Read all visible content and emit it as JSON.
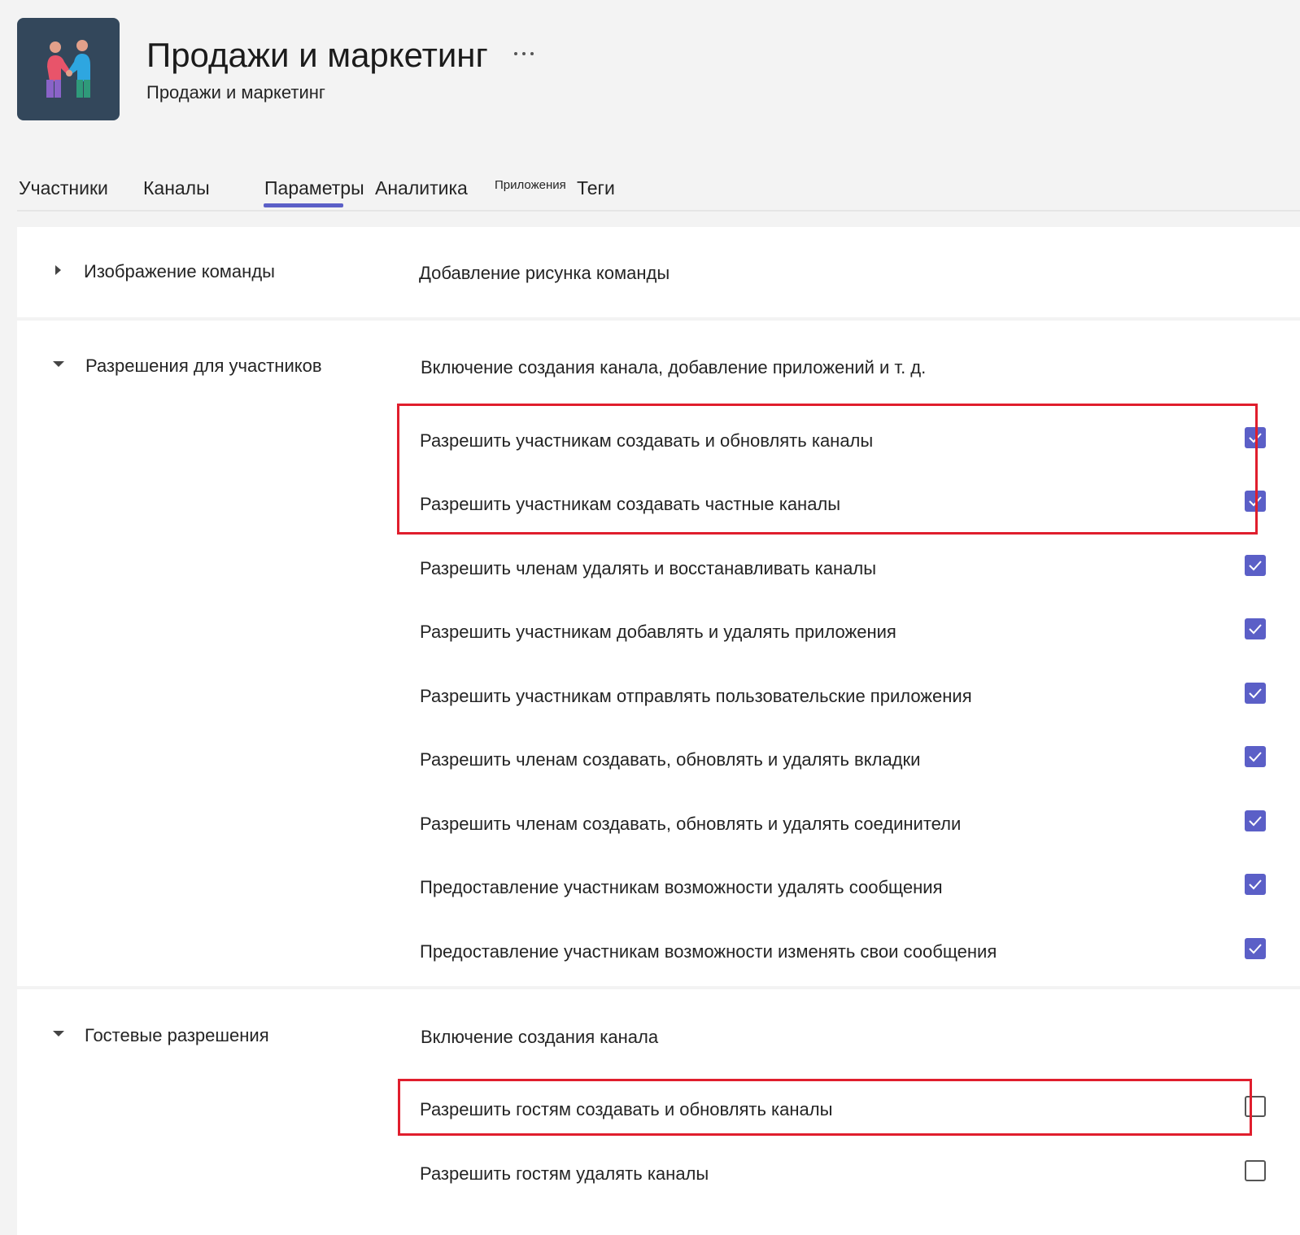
{
  "header": {
    "title": "Продажи и маркетинг",
    "subtitle": "Продажи и маркетинг",
    "more_icon": "more-horizontal-icon",
    "avatar_icon": "team-people-illustration"
  },
  "tabs": [
    {
      "label": "Участники"
    },
    {
      "label": "Каналы"
    },
    {
      "label": "Параметры",
      "active": true
    },
    {
      "label": "Аналитика"
    },
    {
      "label": "Приложения"
    },
    {
      "label": "Теги"
    }
  ],
  "sections": {
    "team_image": {
      "title": "Изображение команды",
      "description": "Добавление рисунка команды",
      "expanded": false
    },
    "member_permissions": {
      "title": "Разрешения для участников",
      "description": "Включение создания канала, добавление приложений и т. д.",
      "expanded": true,
      "options": [
        {
          "label": "Разрешить участникам создавать и обновлять каналы",
          "checked": true
        },
        {
          "label": "Разрешить участникам создавать частные каналы",
          "checked": true
        },
        {
          "label": "Разрешить членам удалять и восстанавливать каналы",
          "checked": true
        },
        {
          "label": "Разрешить участникам добавлять и удалять приложения",
          "checked": true
        },
        {
          "label": "Разрешить участникам отправлять пользовательские приложения",
          "checked": true
        },
        {
          "label": "Разрешить членам создавать, обновлять и удалять вкладки",
          "checked": true
        },
        {
          "label": "Разрешить членам создавать, обновлять и удалять соединители",
          "checked": true
        },
        {
          "label": "Предоставление участникам возможности удалять сообщения",
          "checked": true
        },
        {
          "label": "Предоставление участникам возможности изменять свои сообщения",
          "checked": true
        }
      ]
    },
    "guest_permissions": {
      "title": "Гостевые разрешения",
      "description": "Включение создания канала",
      "expanded": true,
      "options": [
        {
          "label": "Разрешить гостям создавать и обновлять каналы",
          "checked": false
        },
        {
          "label": "Разрешить гостям удалять каналы",
          "checked": false
        }
      ]
    }
  },
  "colors": {
    "accent": "#5b5fc7",
    "highlight": "#e01e2d",
    "avatar_bg": "#33475b"
  }
}
